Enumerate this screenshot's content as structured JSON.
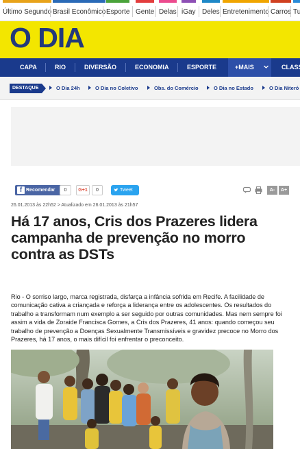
{
  "portal_bar": {
    "items": [
      {
        "label": "Último Segundo",
        "stripe": "#e8a31a"
      },
      {
        "label": "Brasil Econômico",
        "stripe": "#2a6ab7"
      },
      {
        "label": "Esporte",
        "stripe": "#4aa33a"
      },
      {
        "label": "Gente",
        "stripe": "#e33d3d"
      },
      {
        "label": "Delas",
        "stripe": "#ec4b8e"
      },
      {
        "label": "iGay",
        "stripe": "#8d4fb5"
      },
      {
        "label": "Deles",
        "stripe": "#1e88c7"
      },
      {
        "label": "Entretenimento",
        "stripe": "#f0a500"
      },
      {
        "label": "Carros",
        "stripe": "#d04020"
      },
      {
        "label": "Tu",
        "stripe": "#2a8bd8"
      }
    ]
  },
  "masthead": {
    "logo_text": "O DIA",
    "background": "#f3e600",
    "logo_color": "#23397b"
  },
  "main_nav": {
    "items": [
      "CAPA",
      "RIO",
      "DIVERSÃO",
      "ECONOMIA",
      "ESPORTE"
    ],
    "more_label": "+MAIS",
    "overflow_label": "CLASS"
  },
  "destaque": {
    "tag": "DESTAQUE",
    "links": [
      "O Dia 24h",
      "O Dia no Coletivo",
      "Obs. do Comércio",
      "O Dia no Estado",
      "O Dia Niteró"
    ]
  },
  "social": {
    "facebook_label": "Recomendar",
    "facebook_count": "0",
    "gplus_label": "G+1",
    "gplus_count": "0",
    "twitter_label": "Tweet",
    "font_decrease": "A-",
    "font_increase": "A+",
    "icons": [
      "comment-icon",
      "print-icon"
    ]
  },
  "article": {
    "dateline": "26.01.2013 às 22h52 > Atualizado em 26.01.2013 às 21h57",
    "headline": "Há 17 anos, Cris dos Prazeres lidera campanha de prevenção no morro contra as DSTs",
    "lead": "Rio -  O sorriso largo, marca registrada, disfarça a infância sofrida em Recife. A facilidade de comunicação cativa a criançada e reforça a liderança entre os adolescentes. Os resultados do trabalho a transformam num exemplo a ser seguido por outras comunidades. Mas nem sempre foi assim a vida de Zoraide Francisca Gomes, a Cris dos Prazeres, 41 anos: quando começou seu trabalho de prevenção a Doenças Sexualmente Transmissíveis e gravidez precoce no Morro dos Prazeres, há 17 anos, o mais difícil foi enfrentar o preconceito."
  }
}
